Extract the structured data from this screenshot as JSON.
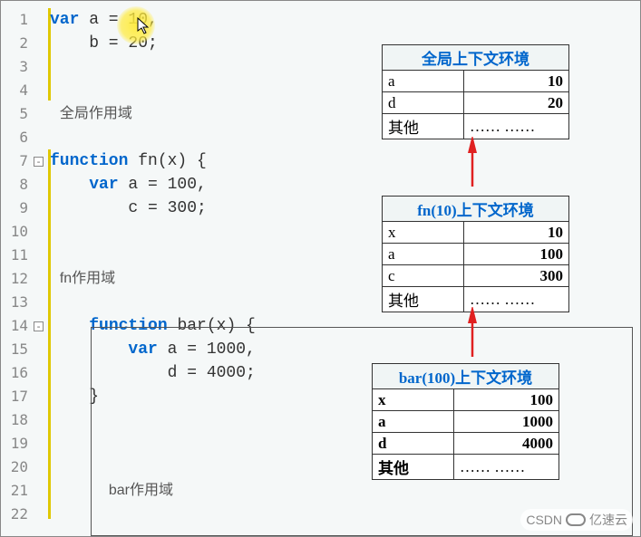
{
  "code_lines": [
    {
      "n": 1,
      "html": "<span class='kw'>var</span> a = 10,"
    },
    {
      "n": 2,
      "html": "    b = 20;"
    },
    {
      "n": 3,
      "html": ""
    },
    {
      "n": 4,
      "html": ""
    },
    {
      "n": 5,
      "html": " <span class='label'>全局作用域</span>"
    },
    {
      "n": 6,
      "html": ""
    },
    {
      "n": 7,
      "html": "<span class='kw'>function</span> fn(x) {",
      "fold": true
    },
    {
      "n": 8,
      "html": "    <span class='kw'>var</span> a = 100,"
    },
    {
      "n": 9,
      "html": "        c = 300;"
    },
    {
      "n": 10,
      "html": ""
    },
    {
      "n": 11,
      "html": ""
    },
    {
      "n": 12,
      "html": " <span class='label'>fn作用域</span>"
    },
    {
      "n": 13,
      "html": ""
    },
    {
      "n": 14,
      "html": "    <span class='kw'>function</span> bar(x) {",
      "fold": true
    },
    {
      "n": 15,
      "html": "        <span class='kw'>var</span> a = 1000,"
    },
    {
      "n": 16,
      "html": "            d = 4000;"
    },
    {
      "n": 17,
      "html": "    }"
    },
    {
      "n": 18,
      "html": ""
    },
    {
      "n": 19,
      "html": ""
    },
    {
      "n": 20,
      "html": ""
    },
    {
      "n": 21,
      "html": "      <span class='label'>bar作用域</span>"
    },
    {
      "n": 22,
      "html": ""
    }
  ],
  "tables": {
    "global": {
      "title": "全局上下文环境",
      "rows": [
        {
          "k": "a",
          "v": "10"
        },
        {
          "k": "d",
          "v": "20"
        },
        {
          "k": "其他",
          "v": "…… ……"
        }
      ]
    },
    "fn": {
      "title": "fn(10)上下文环境",
      "rows": [
        {
          "k": "x",
          "v": "10"
        },
        {
          "k": "a",
          "v": "100"
        },
        {
          "k": "c",
          "v": "300"
        },
        {
          "k": "其他",
          "v": "…… ……"
        }
      ]
    },
    "bar": {
      "title": "bar(100)上下文环境",
      "rows": [
        {
          "k": "x",
          "v": "100"
        },
        {
          "k": "a",
          "v": "1000"
        },
        {
          "k": "d",
          "v": "4000"
        },
        {
          "k": "其他",
          "v": "…… ……"
        }
      ]
    }
  },
  "watermark": {
    "label": "CSDN",
    "brand": "亿速云"
  },
  "scope_labels": {
    "global": "全局作用域",
    "fn": "fn作用域",
    "bar": "bar作用域"
  }
}
